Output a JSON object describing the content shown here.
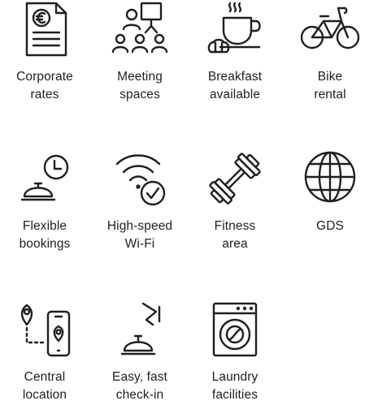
{
  "amenities": [
    {
      "icon": "corporate-rates-icon",
      "line1": "Corporate",
      "line2": "rates"
    },
    {
      "icon": "meeting-spaces-icon",
      "line1": "Meeting",
      "line2": "spaces"
    },
    {
      "icon": "breakfast-icon",
      "line1": "Breakfast",
      "line2": "available"
    },
    {
      "icon": "bike-icon",
      "line1": "Bike",
      "line2": "rental"
    },
    {
      "icon": "flexible-bookings-icon",
      "line1": "Flexible",
      "line2": "bookings"
    },
    {
      "icon": "wifi-icon",
      "line1": "High-speed",
      "line2": "Wi-Fi"
    },
    {
      "icon": "fitness-icon",
      "line1": "Fitness",
      "line2": "area"
    },
    {
      "icon": "gds-globe-icon",
      "line1": "GDS",
      "line2": ""
    },
    {
      "icon": "central-location-icon",
      "line1": "Central",
      "line2": "location"
    },
    {
      "icon": "check-in-bell-icon",
      "line1": "Easy, fast",
      "line2": "check-in"
    },
    {
      "icon": "laundry-icon",
      "line1": "Laundry",
      "line2": "facilities"
    }
  ],
  "colors": {
    "icon_stroke": "#1f1f1f",
    "text": "#1f1f1f",
    "background": "#ffffff"
  }
}
